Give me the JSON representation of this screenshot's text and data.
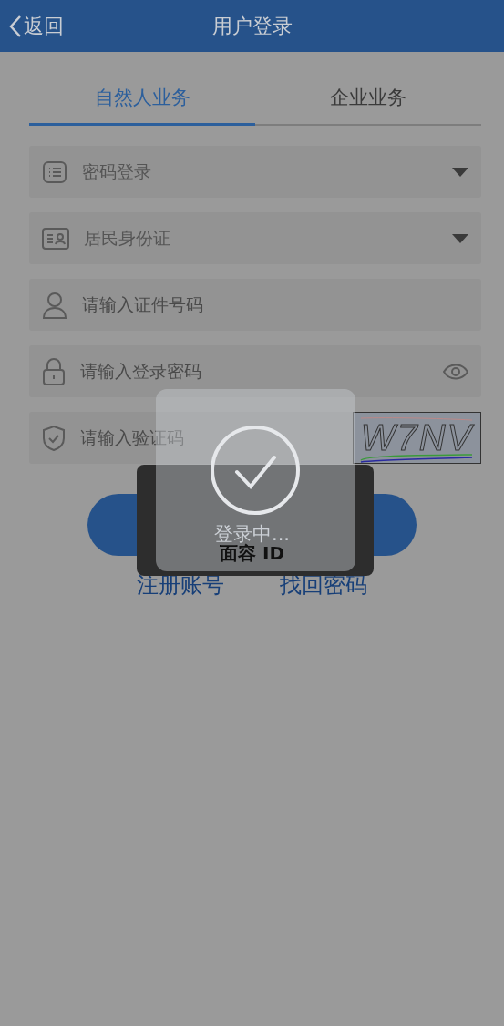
{
  "header": {
    "back": "返回",
    "title": "用户登录"
  },
  "tabs": [
    {
      "label": "自然人业务",
      "selected": true
    },
    {
      "label": "企业业务",
      "selected": false
    }
  ],
  "fields": [
    {
      "kind": "select",
      "value": "密码登录"
    },
    {
      "kind": "select",
      "value": "居民身份证"
    },
    {
      "kind": "input",
      "placeholder": "请输入证件号码"
    },
    {
      "kind": "password",
      "placeholder": "请输入登录密码"
    },
    {
      "kind": "captcha",
      "placeholder": "请输入验证码",
      "captcha_text": "W7NV"
    }
  ],
  "links": [
    "注册账号",
    "找回密码"
  ],
  "loading_toast": {
    "text": "登录中..."
  },
  "face_id_panel": {
    "label": "面容 ID"
  }
}
